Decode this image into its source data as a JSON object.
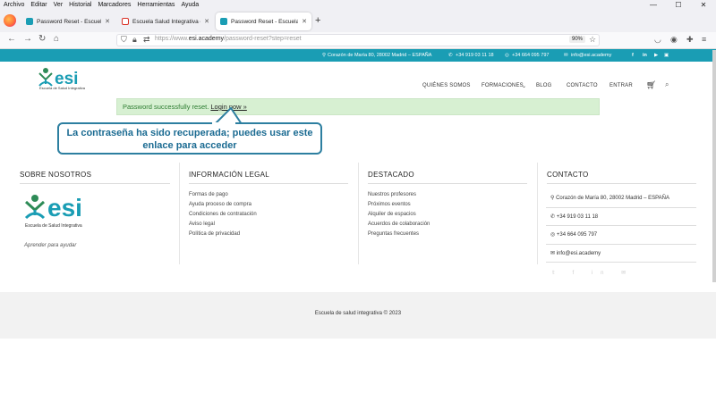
{
  "menubar": [
    "Archivo",
    "Editar",
    "Ver",
    "Historial",
    "Marcadores",
    "Herramientas",
    "Ayuda"
  ],
  "tabs": [
    {
      "label": "Password Reset - Escuela Salud",
      "active": false
    },
    {
      "label": "Escuela Salud Integrativa cambi",
      "active": false
    },
    {
      "label": "Password Reset - Escuela Salud",
      "active": true
    }
  ],
  "address": {
    "scheme": "https://www.",
    "host": "esi.academy",
    "path": "/password-reset?step=reset",
    "zoom": "90%"
  },
  "topbar": {
    "address": "Corazón de María 80, 28002 Madrid – ESPAÑA",
    "phone": "+34 919 03 11 18",
    "mobile": "+34 664 095 797",
    "email": "info@esi.academy",
    "social": [
      "f",
      "in"
    ]
  },
  "logo": {
    "text": "esi",
    "subtitle": "Escuela de Salud Integrativa"
  },
  "nav": [
    {
      "label": "QUIÉNES SOMOS"
    },
    {
      "label": "FORMACIONES"
    },
    {
      "label": "BLOG"
    },
    {
      "label": "CONTACTO"
    },
    {
      "label": "ENTRAR"
    }
  ],
  "alert": {
    "message": "Password successfully reset.",
    "link": "Login now »"
  },
  "callout": {
    "line1": "La contraseña ha sido recuperada; puedes usar este",
    "line2": "enlace para acceder"
  },
  "footer": {
    "about": {
      "title": "SOBRE NOSOTROS",
      "tagline": "Aprender para ayudar"
    },
    "legal": {
      "title": "INFORMACIÓN LEGAL",
      "links": [
        "Formas de pago",
        "Ayuda proceso de compra",
        "Condiciones de contratación",
        "Aviso legal",
        "Política de privacidad"
      ]
    },
    "featured": {
      "title": "DESTACADO",
      "links": [
        "Nuestros profesores",
        "Próximos eventos",
        "Alquiler de espacios",
        "Acuerdos de colaboración",
        "Preguntas frecuentes"
      ]
    },
    "contact": {
      "title": "CONTACTO",
      "address": "Corazón de María 80, 28002 Madrid – ESPAÑA",
      "phone": "+34 919 03 11 18",
      "whatsapp": "+34 664 095 797",
      "email": "info@esi.academy"
    },
    "copyright": "Escuela de salud integrativa © 2023"
  },
  "colors": {
    "brand": "#1a9db4",
    "alert_bg": "#d7f0d2",
    "callout_border": "#2d7fa0"
  }
}
